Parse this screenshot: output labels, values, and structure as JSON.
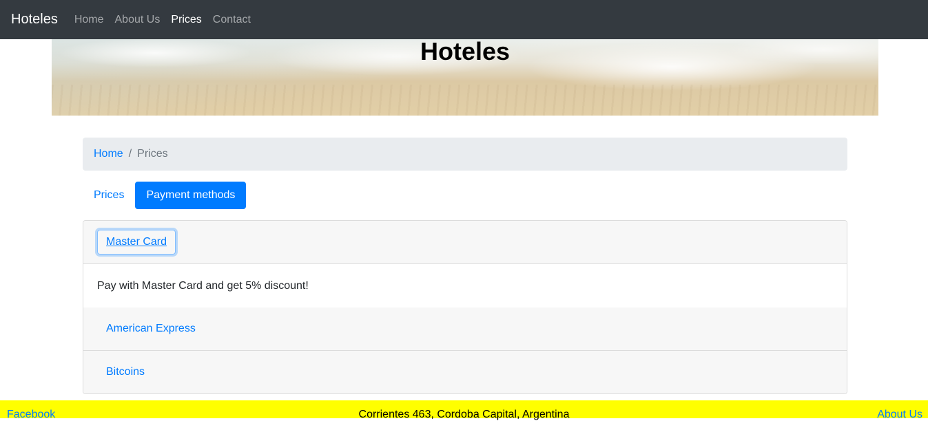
{
  "navbar": {
    "brand": "Hoteles",
    "links": [
      {
        "label": "Home"
      },
      {
        "label": "About Us"
      },
      {
        "label": "Prices"
      },
      {
        "label": "Contact"
      }
    ],
    "active": "Prices"
  },
  "hero": {
    "title": "Hoteles"
  },
  "breadcrumb": {
    "home": "Home",
    "separator": "/",
    "current": "Prices"
  },
  "tabs": [
    {
      "label": "Prices",
      "active": false
    },
    {
      "label": "Payment methods",
      "active": true
    }
  ],
  "accordion": {
    "items": [
      {
        "title": "Master Card",
        "body": "Pay with Master Card and get 5% discount!",
        "expanded": true
      },
      {
        "title": "American Express",
        "expanded": false
      },
      {
        "title": "Bitcoins",
        "expanded": false
      }
    ]
  },
  "footer": {
    "left": "Facebook",
    "center": "Corrientes 463, Cordoba Capital, Argentina",
    "right": "About Us"
  },
  "colors": {
    "navbar_bg": "#343a40",
    "primary": "#007bff",
    "footer_bg": "#ffff00",
    "breadcrumb_bg": "#e9ecef"
  }
}
